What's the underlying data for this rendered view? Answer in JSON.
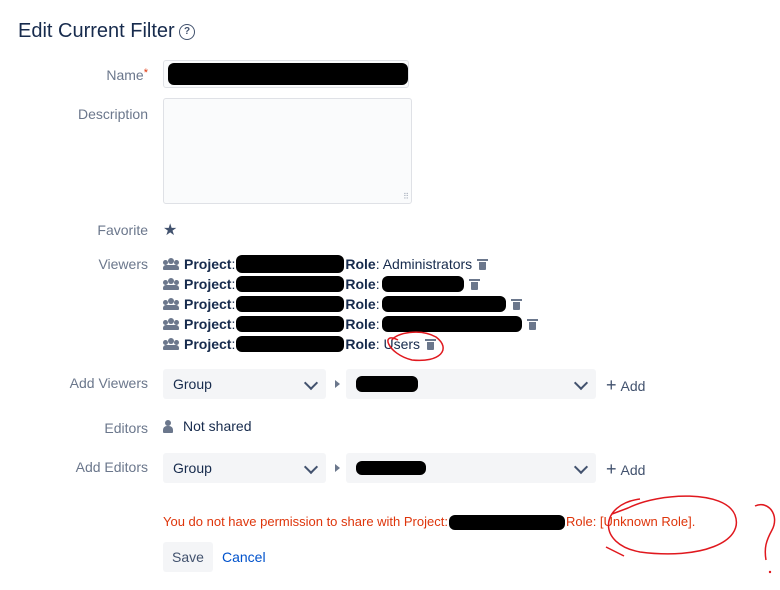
{
  "header": {
    "title": "Edit Current Filter",
    "help_icon": "question-circle-icon"
  },
  "form": {
    "name_label": "Name",
    "required_mark": "*",
    "description_label": "Description",
    "favorite_label": "Favorite",
    "viewers_label": "Viewers",
    "add_viewers_label": "Add Viewers",
    "editors_label": "Editors",
    "add_editors_label": "Add Editors"
  },
  "viewers": {
    "items": [
      {
        "project_label": "Project",
        "role_label": "Role",
        "role_value": ": Administrators"
      },
      {
        "project_label": "Project",
        "role_label": "Role",
        "role_value": ":"
      },
      {
        "project_label": "Project",
        "role_label": "Role",
        "role_value": ":"
      },
      {
        "project_label": "Project",
        "role_label": "Role",
        "role_value": ":"
      },
      {
        "project_label": "Project",
        "role_label": "Role",
        "role_value": ": Users"
      }
    ]
  },
  "add_viewers": {
    "type_select": "Group",
    "add_label": "Add"
  },
  "editors": {
    "value": "Not shared"
  },
  "add_editors": {
    "type_select": "Group",
    "add_label": "Add"
  },
  "error": {
    "prefix": "You do not have permission to share with Project:",
    "suffix": "Role: [Unknown Role]."
  },
  "actions": {
    "save_label": "Save",
    "cancel_label": "Cancel"
  },
  "annotations": {
    "question_mark": "?"
  },
  "colors": {
    "text": "#172b4d",
    "muted": "#6b778c",
    "error": "#de350b",
    "link": "#0052cc",
    "annotation": "#e0181e"
  }
}
